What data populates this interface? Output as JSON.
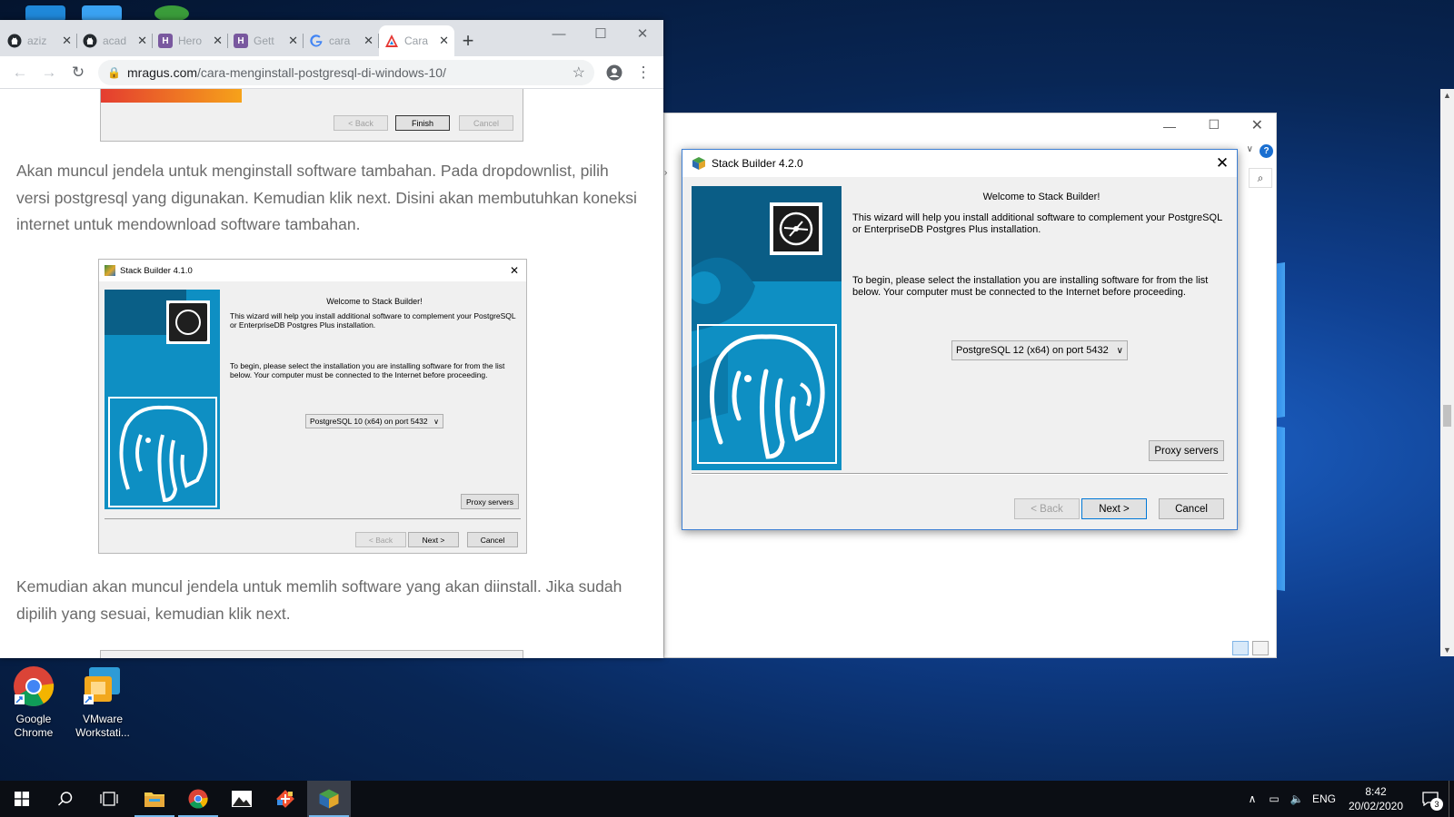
{
  "browser": {
    "tabs": [
      {
        "title": "aziz",
        "favicon": "github-icon"
      },
      {
        "title": "acad",
        "favicon": "github-icon"
      },
      {
        "title": "Hero",
        "favicon": "heroku-icon"
      },
      {
        "title": "Gett",
        "favicon": "heroku-icon"
      },
      {
        "title": "cara",
        "favicon": "google-icon"
      },
      {
        "title": "Cara",
        "favicon": "mragus-icon"
      }
    ],
    "new_tab_label": "+",
    "close_glyph": "✕",
    "url_host": "mragus.com",
    "url_path": "/cara-menginstall-postgresql-di-windows-10/"
  },
  "article": {
    "para1": "Akan muncul jendela untuk menginstall software tambahan. Pada dropdownlist, pilih versi postgresql yang digunakan. Kemudian klik next. Disini akan membutuhkan koneksi internet untuk mendownload software tambahan.",
    "para2": "Kemudian akan muncul jendela untuk memlih software yang akan diinstall. Jika sudah dipilih yang sesuai, kemudian klik next.",
    "top_shot": {
      "back": "< Back",
      "finish": "Finish",
      "cancel": "Cancel"
    },
    "embedded_wizard": {
      "title": "Stack Builder 4.1.0",
      "welcome": "Welcome to Stack Builder!",
      "intro": "This wizard will help you install additional software to complement your PostgreSQL or EnterpriseDB Postgres Plus installation.",
      "begin": "To begin, please select the installation you are installing software for from the list below. Your computer must be connected to the Internet before proceeding.",
      "selected": "PostgreSQL 10 (x64) on port 5432",
      "proxy": "Proxy servers",
      "back": "< Back",
      "next": "Next >",
      "cancel": "Cancel"
    }
  },
  "wizard": {
    "title": "Stack Builder 4.2.0",
    "welcome": "Welcome to Stack Builder!",
    "intro": "This wizard will help you install additional software to complement your PostgreSQL or EnterpriseDB Postgres Plus installation.",
    "begin": "To begin, please select the installation you are installing software for from the list below. Your computer must be connected to the Internet before proceeding.",
    "selected_installation": "PostgreSQL 12 (x64) on port 5432",
    "proxy": "Proxy servers",
    "back": "< Back",
    "next": "Next >",
    "cancel": "Cancel"
  },
  "desktop_icons": [
    {
      "label": "Google Chrome"
    },
    {
      "label": "VMware Workstati..."
    }
  ],
  "taskbar": {
    "language": "ENG",
    "time": "8:42",
    "date": "20/02/2020",
    "notifications": "3"
  },
  "colors": {
    "accent": "#0078d7",
    "banner_blue": "#0e8fc3",
    "desktop_blue": "#0f3f8f"
  }
}
